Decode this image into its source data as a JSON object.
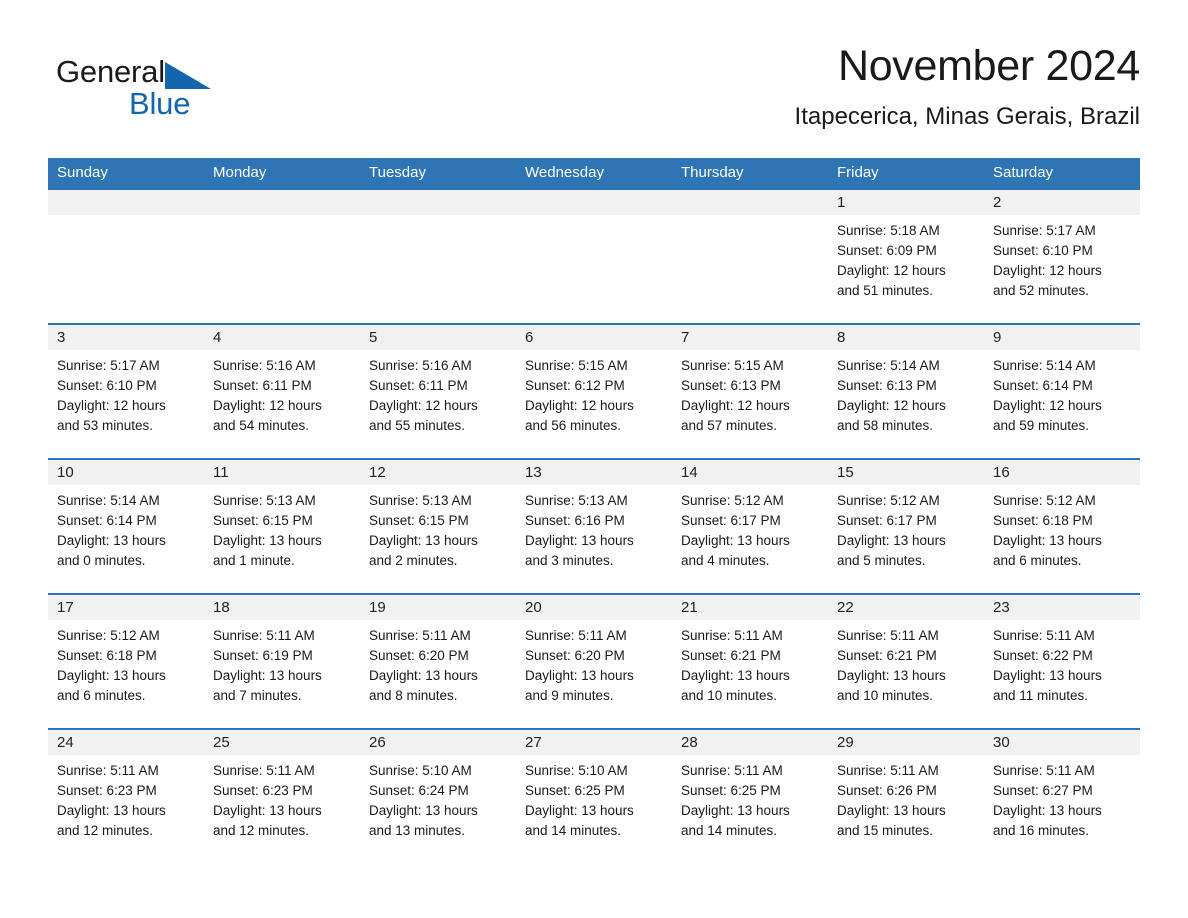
{
  "brand": {
    "name_part1": "General",
    "name_part2": "Blue",
    "color_primary": "#2e75b6",
    "color_logo_blue": "#1266b0"
  },
  "header": {
    "month_title": "November 2024",
    "location": "Itapecerica, Minas Gerais, Brazil"
  },
  "calendar": {
    "day_headers": [
      "Sunday",
      "Monday",
      "Tuesday",
      "Wednesday",
      "Thursday",
      "Friday",
      "Saturday"
    ],
    "weeks": [
      [
        {
          "day": "",
          "sunrise": "",
          "sunset": "",
          "daylight_line1": "",
          "daylight_line2": ""
        },
        {
          "day": "",
          "sunrise": "",
          "sunset": "",
          "daylight_line1": "",
          "daylight_line2": ""
        },
        {
          "day": "",
          "sunrise": "",
          "sunset": "",
          "daylight_line1": "",
          "daylight_line2": ""
        },
        {
          "day": "",
          "sunrise": "",
          "sunset": "",
          "daylight_line1": "",
          "daylight_line2": ""
        },
        {
          "day": "",
          "sunrise": "",
          "sunset": "",
          "daylight_line1": "",
          "daylight_line2": ""
        },
        {
          "day": "1",
          "sunrise": "Sunrise: 5:18 AM",
          "sunset": "Sunset: 6:09 PM",
          "daylight_line1": "Daylight: 12 hours",
          "daylight_line2": "and 51 minutes."
        },
        {
          "day": "2",
          "sunrise": "Sunrise: 5:17 AM",
          "sunset": "Sunset: 6:10 PM",
          "daylight_line1": "Daylight: 12 hours",
          "daylight_line2": "and 52 minutes."
        }
      ],
      [
        {
          "day": "3",
          "sunrise": "Sunrise: 5:17 AM",
          "sunset": "Sunset: 6:10 PM",
          "daylight_line1": "Daylight: 12 hours",
          "daylight_line2": "and 53 minutes."
        },
        {
          "day": "4",
          "sunrise": "Sunrise: 5:16 AM",
          "sunset": "Sunset: 6:11 PM",
          "daylight_line1": "Daylight: 12 hours",
          "daylight_line2": "and 54 minutes."
        },
        {
          "day": "5",
          "sunrise": "Sunrise: 5:16 AM",
          "sunset": "Sunset: 6:11 PM",
          "daylight_line1": "Daylight: 12 hours",
          "daylight_line2": "and 55 minutes."
        },
        {
          "day": "6",
          "sunrise": "Sunrise: 5:15 AM",
          "sunset": "Sunset: 6:12 PM",
          "daylight_line1": "Daylight: 12 hours",
          "daylight_line2": "and 56 minutes."
        },
        {
          "day": "7",
          "sunrise": "Sunrise: 5:15 AM",
          "sunset": "Sunset: 6:13 PM",
          "daylight_line1": "Daylight: 12 hours",
          "daylight_line2": "and 57 minutes."
        },
        {
          "day": "8",
          "sunrise": "Sunrise: 5:14 AM",
          "sunset": "Sunset: 6:13 PM",
          "daylight_line1": "Daylight: 12 hours",
          "daylight_line2": "and 58 minutes."
        },
        {
          "day": "9",
          "sunrise": "Sunrise: 5:14 AM",
          "sunset": "Sunset: 6:14 PM",
          "daylight_line1": "Daylight: 12 hours",
          "daylight_line2": "and 59 minutes."
        }
      ],
      [
        {
          "day": "10",
          "sunrise": "Sunrise: 5:14 AM",
          "sunset": "Sunset: 6:14 PM",
          "daylight_line1": "Daylight: 13 hours",
          "daylight_line2": "and 0 minutes."
        },
        {
          "day": "11",
          "sunrise": "Sunrise: 5:13 AM",
          "sunset": "Sunset: 6:15 PM",
          "daylight_line1": "Daylight: 13 hours",
          "daylight_line2": "and 1 minute."
        },
        {
          "day": "12",
          "sunrise": "Sunrise: 5:13 AM",
          "sunset": "Sunset: 6:15 PM",
          "daylight_line1": "Daylight: 13 hours",
          "daylight_line2": "and 2 minutes."
        },
        {
          "day": "13",
          "sunrise": "Sunrise: 5:13 AM",
          "sunset": "Sunset: 6:16 PM",
          "daylight_line1": "Daylight: 13 hours",
          "daylight_line2": "and 3 minutes."
        },
        {
          "day": "14",
          "sunrise": "Sunrise: 5:12 AM",
          "sunset": "Sunset: 6:17 PM",
          "daylight_line1": "Daylight: 13 hours",
          "daylight_line2": "and 4 minutes."
        },
        {
          "day": "15",
          "sunrise": "Sunrise: 5:12 AM",
          "sunset": "Sunset: 6:17 PM",
          "daylight_line1": "Daylight: 13 hours",
          "daylight_line2": "and 5 minutes."
        },
        {
          "day": "16",
          "sunrise": "Sunrise: 5:12 AM",
          "sunset": "Sunset: 6:18 PM",
          "daylight_line1": "Daylight: 13 hours",
          "daylight_line2": "and 6 minutes."
        }
      ],
      [
        {
          "day": "17",
          "sunrise": "Sunrise: 5:12 AM",
          "sunset": "Sunset: 6:18 PM",
          "daylight_line1": "Daylight: 13 hours",
          "daylight_line2": "and 6 minutes."
        },
        {
          "day": "18",
          "sunrise": "Sunrise: 5:11 AM",
          "sunset": "Sunset: 6:19 PM",
          "daylight_line1": "Daylight: 13 hours",
          "daylight_line2": "and 7 minutes."
        },
        {
          "day": "19",
          "sunrise": "Sunrise: 5:11 AM",
          "sunset": "Sunset: 6:20 PM",
          "daylight_line1": "Daylight: 13 hours",
          "daylight_line2": "and 8 minutes."
        },
        {
          "day": "20",
          "sunrise": "Sunrise: 5:11 AM",
          "sunset": "Sunset: 6:20 PM",
          "daylight_line1": "Daylight: 13 hours",
          "daylight_line2": "and 9 minutes."
        },
        {
          "day": "21",
          "sunrise": "Sunrise: 5:11 AM",
          "sunset": "Sunset: 6:21 PM",
          "daylight_line1": "Daylight: 13 hours",
          "daylight_line2": "and 10 minutes."
        },
        {
          "day": "22",
          "sunrise": "Sunrise: 5:11 AM",
          "sunset": "Sunset: 6:21 PM",
          "daylight_line1": "Daylight: 13 hours",
          "daylight_line2": "and 10 minutes."
        },
        {
          "day": "23",
          "sunrise": "Sunrise: 5:11 AM",
          "sunset": "Sunset: 6:22 PM",
          "daylight_line1": "Daylight: 13 hours",
          "daylight_line2": "and 11 minutes."
        }
      ],
      [
        {
          "day": "24",
          "sunrise": "Sunrise: 5:11 AM",
          "sunset": "Sunset: 6:23 PM",
          "daylight_line1": "Daylight: 13 hours",
          "daylight_line2": "and 12 minutes."
        },
        {
          "day": "25",
          "sunrise": "Sunrise: 5:11 AM",
          "sunset": "Sunset: 6:23 PM",
          "daylight_line1": "Daylight: 13 hours",
          "daylight_line2": "and 12 minutes."
        },
        {
          "day": "26",
          "sunrise": "Sunrise: 5:10 AM",
          "sunset": "Sunset: 6:24 PM",
          "daylight_line1": "Daylight: 13 hours",
          "daylight_line2": "and 13 minutes."
        },
        {
          "day": "27",
          "sunrise": "Sunrise: 5:10 AM",
          "sunset": "Sunset: 6:25 PM",
          "daylight_line1": "Daylight: 13 hours",
          "daylight_line2": "and 14 minutes."
        },
        {
          "day": "28",
          "sunrise": "Sunrise: 5:11 AM",
          "sunset": "Sunset: 6:25 PM",
          "daylight_line1": "Daylight: 13 hours",
          "daylight_line2": "and 14 minutes."
        },
        {
          "day": "29",
          "sunrise": "Sunrise: 5:11 AM",
          "sunset": "Sunset: 6:26 PM",
          "daylight_line1": "Daylight: 13 hours",
          "daylight_line2": "and 15 minutes."
        },
        {
          "day": "30",
          "sunrise": "Sunrise: 5:11 AM",
          "sunset": "Sunset: 6:27 PM",
          "daylight_line1": "Daylight: 13 hours",
          "daylight_line2": "and 16 minutes."
        }
      ]
    ]
  }
}
